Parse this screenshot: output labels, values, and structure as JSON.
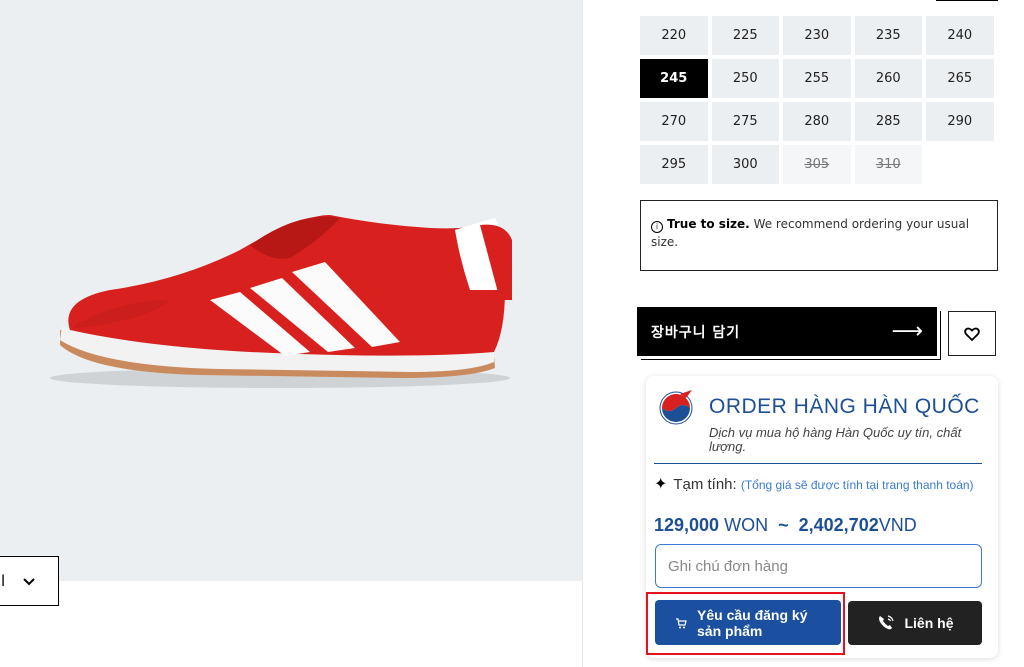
{
  "left": {
    "dropdown_value": "l"
  },
  "sizes": [
    {
      "label": "220",
      "state": "normal"
    },
    {
      "label": "225",
      "state": "normal"
    },
    {
      "label": "230",
      "state": "normal"
    },
    {
      "label": "235",
      "state": "normal"
    },
    {
      "label": "240",
      "state": "normal"
    },
    {
      "label": "245",
      "state": "selected"
    },
    {
      "label": "250",
      "state": "normal"
    },
    {
      "label": "255",
      "state": "normal"
    },
    {
      "label": "260",
      "state": "normal"
    },
    {
      "label": "265",
      "state": "normal"
    },
    {
      "label": "270",
      "state": "normal"
    },
    {
      "label": "275",
      "state": "normal"
    },
    {
      "label": "280",
      "state": "normal"
    },
    {
      "label": "285",
      "state": "normal"
    },
    {
      "label": "290",
      "state": "normal"
    },
    {
      "label": "295",
      "state": "normal"
    },
    {
      "label": "300",
      "state": "normal"
    },
    {
      "label": "305",
      "state": "disabled"
    },
    {
      "label": "310",
      "state": "disabled"
    }
  ],
  "fit_note": {
    "bold": "True to size.",
    "text": " We recommend ordering your usual size."
  },
  "cart": {
    "label": "장바구니 담기",
    "arrow": "⟶"
  },
  "order": {
    "title": "ORDER HÀNG HÀN QUỐC",
    "subtitle": "Dịch vụ mua hộ hàng Hàn Quốc uy tín, chất lượng.",
    "estimate_label": "Tạm tính:",
    "estimate_hint": "(Tổng giá sẽ được tính tại trang thanh toán)",
    "price_won": "129,000",
    "won_unit": "WON",
    "tilde": "~",
    "price_vnd": "2,402,702",
    "vnd_unit": "VND",
    "note_placeholder": "Ghi chú đơn hàng",
    "request_label": "Yêu cầu đăng ký sản phẩm",
    "contact_label": "Liên hệ"
  },
  "colors": {
    "brand_blue": "#1d4f96",
    "highlight_red": "#e8101a",
    "shoe_red": "#d8211f"
  }
}
